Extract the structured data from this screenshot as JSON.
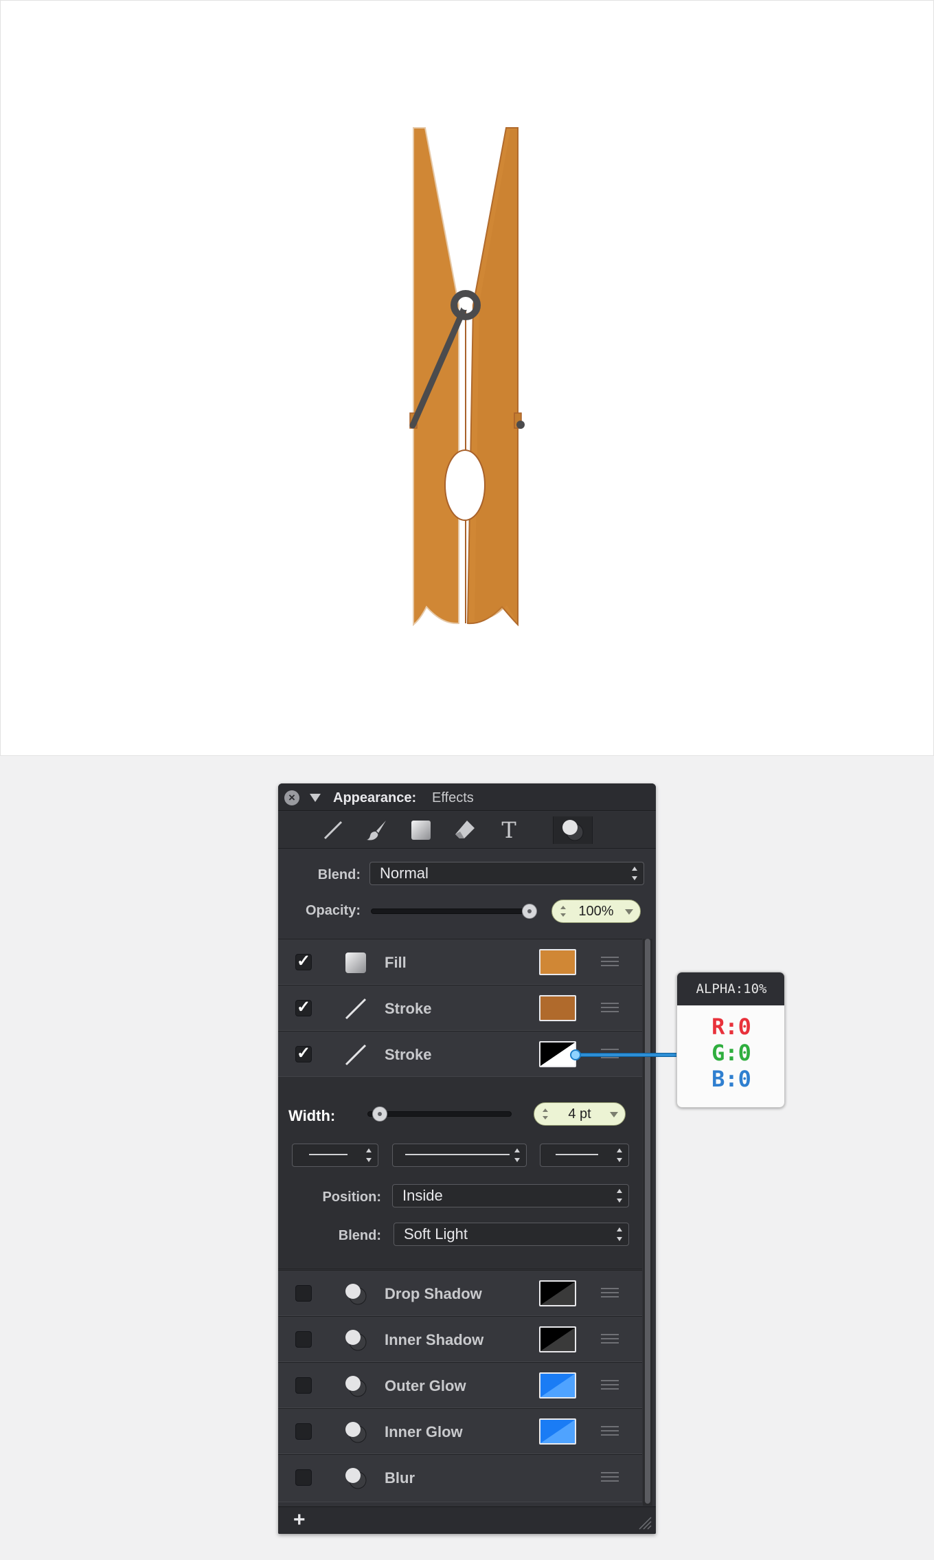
{
  "panel": {
    "title": "Appearance:",
    "subtitle": "Effects",
    "toolbar": {
      "tools": [
        "line-tool-icon",
        "brush-icon",
        "fill-square-icon",
        "eraser-icon",
        "text-icon",
        "effects-icon"
      ],
      "text_tool_glyph": "T",
      "active_tool": "effects"
    },
    "blend_label": "Blend:",
    "blend_value": "Normal",
    "opacity_label": "Opacity:",
    "opacity_value": "100%",
    "opacity_level": 1.0,
    "layers": [
      {
        "name": "Fill",
        "checked": true,
        "icon": "fill-square-icon",
        "color": "#d08735",
        "check_glyph": "✓"
      },
      {
        "name": "Stroke",
        "checked": true,
        "icon": "line-icon",
        "color": "#b06a2c",
        "check_glyph": "✓"
      },
      {
        "name": "Stroke",
        "checked": true,
        "icon": "line-icon",
        "color": "#000000 / transparent",
        "check_glyph": "✓"
      }
    ],
    "stroke_options": {
      "width_label": "Width:",
      "width_value": "4 pt",
      "width_level": 0.05,
      "position_label": "Position:",
      "position_value": "Inside",
      "blend_label": "Blend:",
      "blend_value": "Soft Light"
    },
    "effects": [
      {
        "name": "Drop Shadow",
        "checked": false,
        "color": "#000000"
      },
      {
        "name": "Inner Shadow",
        "checked": false,
        "color": "#000000"
      },
      {
        "name": "Outer Glow",
        "checked": false,
        "color": "#1a7cf5"
      },
      {
        "name": "Inner Glow",
        "checked": false,
        "color": "#1a7cf5"
      },
      {
        "name": "Blur",
        "checked": false
      }
    ],
    "footer": {
      "add_label": "+"
    }
  },
  "callout": {
    "alpha": "ALPHA:10%",
    "r": "R:0",
    "g": "G:0",
    "b": "B:0",
    "r_color": "#e8313b",
    "g_color": "#2fae3e",
    "b_color": "#2f7fd0"
  },
  "artwork": {
    "fill_color": "#d08735",
    "stroke_color": "#b06a2c",
    "spring_color": "#4b4b4d"
  }
}
